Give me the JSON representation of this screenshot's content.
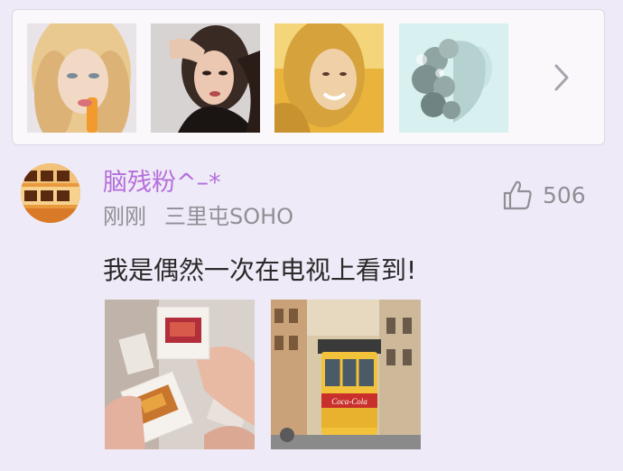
{
  "photo_strip": {
    "thumbnails": [
      {
        "icon": "blonde-woman-photo"
      },
      {
        "icon": "brunette-woman-photo"
      },
      {
        "icon": "smiling-blonde-photo"
      },
      {
        "icon": "double-exposure-photo"
      }
    ],
    "more_icon": "chevron-right-icon"
  },
  "post": {
    "username": "脑残粉^–*",
    "time": "刚刚",
    "location": "三里屯SOHO",
    "like_count": "506",
    "text": "我是偶然一次在电视上看到!",
    "images": [
      {
        "icon": "photo-slides-image"
      },
      {
        "icon": "tram-street-image"
      }
    ],
    "tram_sign": "Coca-Cola"
  },
  "colors": {
    "background": "#efeaf7",
    "username": "#b56fdb",
    "meta": "#8f8f94",
    "text": "#2a2a2a"
  }
}
